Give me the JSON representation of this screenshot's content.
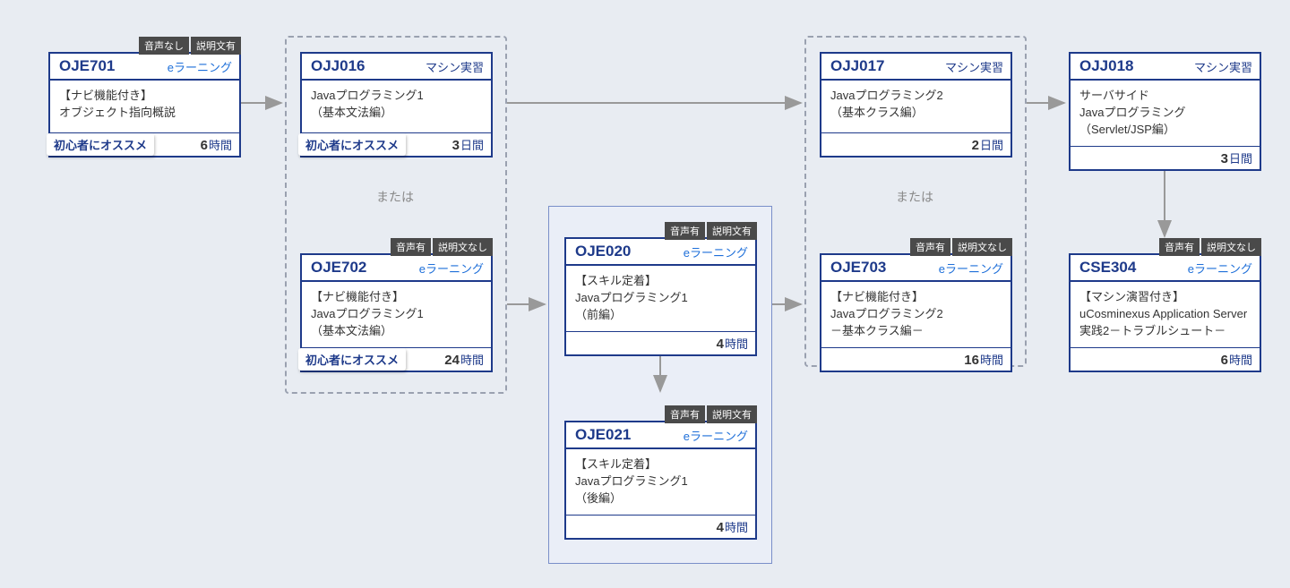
{
  "labels": {
    "or": "または",
    "recommend": "初心者にオススメ",
    "type_elearning": "eラーニング",
    "type_machine": "マシン実習",
    "audio_yes": "音声有",
    "audio_no": "音声なし",
    "desc_yes": "説明文有",
    "desc_no": "説明文なし"
  },
  "cards": {
    "oje701": {
      "code": "OJE701",
      "type": "eラーニング",
      "title": "【ナビ機能付き】\nオブジェクト指向概説",
      "duration_num": "6",
      "duration_unit": "時間",
      "recommend": true,
      "audio": "音声なし",
      "desc": "説明文有"
    },
    "ojj016": {
      "code": "OJJ016",
      "type": "マシン実習",
      "title": "Javaプログラミング1\n（基本文法編）",
      "duration_num": "3",
      "duration_unit": "日間",
      "recommend": true
    },
    "oje702": {
      "code": "OJE702",
      "type": "eラーニング",
      "title": "【ナビ機能付き】\nJavaプログラミング1\n（基本文法編）",
      "duration_num": "24",
      "duration_unit": "時間",
      "recommend": true,
      "audio": "音声有",
      "desc": "説明文なし"
    },
    "oje020": {
      "code": "OJE020",
      "type": "eラーニング",
      "title": "【スキル定着】\nJavaプログラミング1\n（前編）",
      "duration_num": "4",
      "duration_unit": "時間",
      "audio": "音声有",
      "desc": "説明文有"
    },
    "oje021": {
      "code": "OJE021",
      "type": "eラーニング",
      "title": "【スキル定着】\nJavaプログラミング1\n（後編）",
      "duration_num": "4",
      "duration_unit": "時間",
      "audio": "音声有",
      "desc": "説明文有"
    },
    "ojj017": {
      "code": "OJJ017",
      "type": "マシン実習",
      "title": "Javaプログラミング2\n（基本クラス編）",
      "duration_num": "2",
      "duration_unit": "日間"
    },
    "oje703": {
      "code": "OJE703",
      "type": "eラーニング",
      "title": "【ナビ機能付き】\nJavaプログラミング2\n－基本クラス編－",
      "duration_num": "16",
      "duration_unit": "時間",
      "audio": "音声有",
      "desc": "説明文なし"
    },
    "ojj018": {
      "code": "OJJ018",
      "type": "マシン実習",
      "title": "サーバサイド\nJavaプログラミング\n（Servlet/JSP編）",
      "duration_num": "3",
      "duration_unit": "日間"
    },
    "cse304": {
      "code": "CSE304",
      "type": "eラーニング",
      "title": "【マシン演習付き】\nuCosminexus Application Server実践2－トラブルシュート－",
      "duration_num": "6",
      "duration_unit": "時間",
      "audio": "音声有",
      "desc": "説明文なし"
    }
  }
}
